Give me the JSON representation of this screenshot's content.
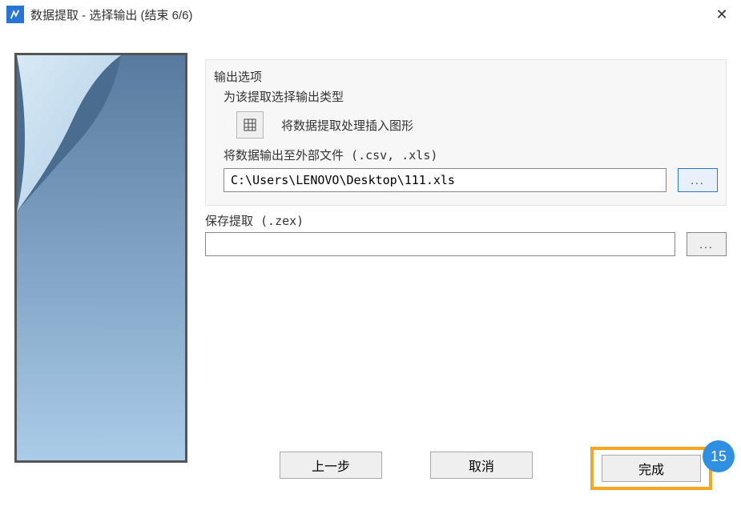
{
  "titlebar": {
    "title": "数据提取 - 选择输出 (结束 6/6)"
  },
  "output_options": {
    "section_label": "输出选项",
    "subtext": "为该提取选择输出类型",
    "insert_graphic_label": "将数据提取处理插入图形",
    "external_file_label": "将数据输出至外部文件 (.csv, .xls)",
    "file_path": "C:\\Users\\LENOVO\\Desktop\\111.xls",
    "browse_label": "..."
  },
  "save_extract": {
    "label": "保存提取 (.zex)",
    "file_path": "",
    "browse_label": "..."
  },
  "buttons": {
    "prev": "上一步",
    "cancel": "取消",
    "finish": "完成"
  },
  "annotation": {
    "step_number": "15"
  }
}
